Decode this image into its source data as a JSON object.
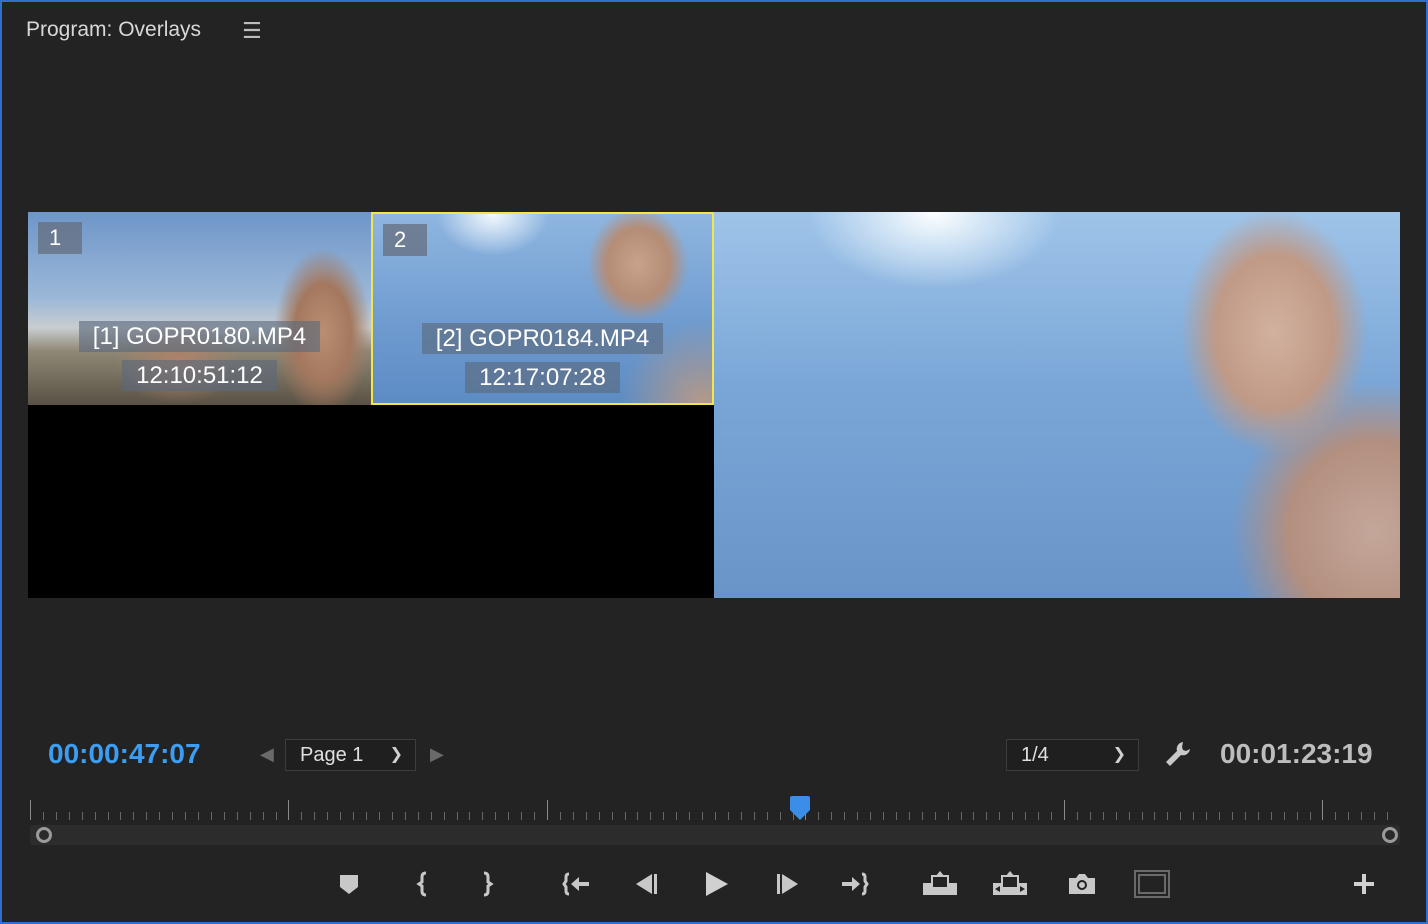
{
  "panel": {
    "title": "Program: Overlays",
    "menu_icon": "hamburger-menu-icon"
  },
  "multicam": {
    "cameras": [
      {
        "number": "1",
        "name": "[1] GOPR0180.MP4",
        "timecode": "12:10:51:12",
        "selected": false
      },
      {
        "number": "2",
        "name": "[2] GOPR0184.MP4",
        "timecode": "12:17:07:28",
        "selected": true
      }
    ],
    "selected_border_color": "#f1e64a"
  },
  "controls": {
    "current_timecode": "00:00:47:07",
    "current_timecode_color": "#3d9df3",
    "page_select": "Page 1",
    "resolution_select": "1/4",
    "duration_timecode": "00:01:23:19"
  },
  "timeline": {
    "playhead_color": "#3b8ee8",
    "playhead_fraction": 0.562
  },
  "transport": [
    {
      "name": "add-marker-button",
      "icon": "marker-icon"
    },
    {
      "name": "mark-in-button",
      "icon": "mark-in-icon"
    },
    {
      "name": "mark-out-button",
      "icon": "mark-out-icon"
    },
    {
      "name": "go-to-in-button",
      "icon": "go-to-in-icon"
    },
    {
      "name": "step-back-button",
      "icon": "step-back-icon"
    },
    {
      "name": "play-button",
      "icon": "play-icon"
    },
    {
      "name": "step-forward-button",
      "icon": "step-forward-icon"
    },
    {
      "name": "go-to-out-button",
      "icon": "go-to-out-icon"
    },
    {
      "name": "lift-button",
      "icon": "lift-icon"
    },
    {
      "name": "extract-button",
      "icon": "extract-icon"
    },
    {
      "name": "export-frame-button",
      "icon": "camera-icon"
    },
    {
      "name": "toggle-proxy-button",
      "icon": "frame-icon"
    },
    {
      "name": "button-editor-button",
      "icon": "plus-icon"
    }
  ]
}
